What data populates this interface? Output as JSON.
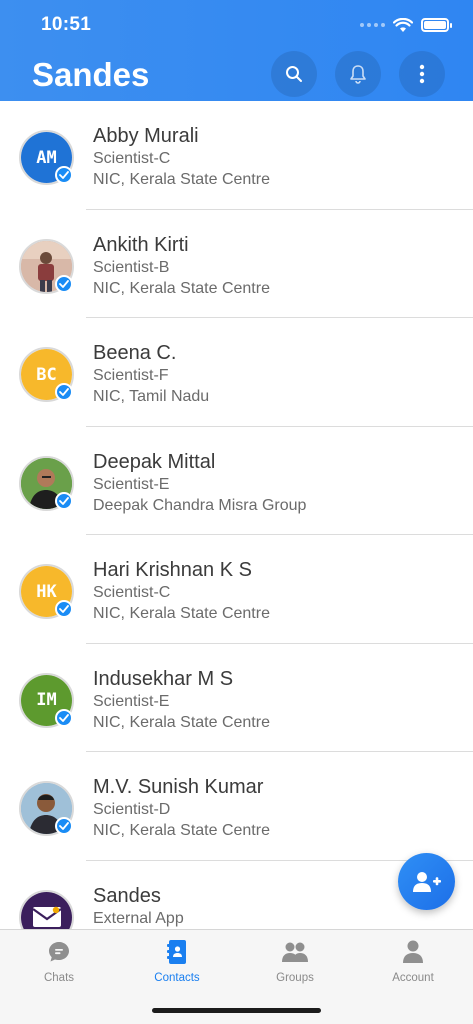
{
  "status_bar": {
    "time": "10:51"
  },
  "header": {
    "title": "Sandes"
  },
  "contacts": [
    {
      "initials": "AM",
      "name": "Abby Murali",
      "designation": "Scientist-C",
      "organization": "NIC, Kerala State Centre",
      "avatar_color": "#1f73d6",
      "avatar_type": "initials"
    },
    {
      "initials": "",
      "name": "Ankith Kirti",
      "designation": "Scientist-B",
      "organization": "NIC, Kerala State Centre",
      "avatar_color": "#b88a7a",
      "avatar_type": "photo"
    },
    {
      "initials": "BC",
      "name": "Beena C.",
      "designation": "Scientist-F",
      "organization": "NIC, Tamil Nadu",
      "avatar_color": "#f7b82b",
      "avatar_type": "initials"
    },
    {
      "initials": "",
      "name": "Deepak Mittal",
      "designation": "Scientist-E",
      "organization": "Deepak Chandra Misra Group",
      "avatar_color": "#4f8a3a",
      "avatar_type": "photo"
    },
    {
      "initials": "HK",
      "name": "Hari Krishnan K S",
      "designation": "Scientist-C",
      "organization": "NIC, Kerala State Centre",
      "avatar_color": "#f7b82b",
      "avatar_type": "initials"
    },
    {
      "initials": "IM",
      "name": "Indusekhar M S",
      "designation": "Scientist-E",
      "organization": "NIC, Kerala State Centre",
      "avatar_color": "#5d9a2e",
      "avatar_type": "initials"
    },
    {
      "initials": "",
      "name": "M.V. Sunish Kumar",
      "designation": "Scientist-D",
      "organization": "NIC, Kerala State Centre",
      "avatar_color": "#7aa7c7",
      "avatar_type": "photo"
    },
    {
      "initials": "",
      "name": "Sandes",
      "designation": "External App",
      "organization": "",
      "avatar_color": "#3b1f5c",
      "avatar_type": "logo"
    }
  ],
  "tabs": [
    {
      "label": "Chats",
      "icon": "chat-bubble-icon",
      "active": false
    },
    {
      "label": "Contacts",
      "icon": "contact-card-icon",
      "active": true
    },
    {
      "label": "Groups",
      "icon": "group-icon",
      "active": false
    },
    {
      "label": "Account",
      "icon": "person-icon",
      "active": false
    }
  ],
  "colors": {
    "accent": "#2f86f2",
    "verified": "#1a8cf5",
    "active_tab": "#1a7ff0"
  }
}
